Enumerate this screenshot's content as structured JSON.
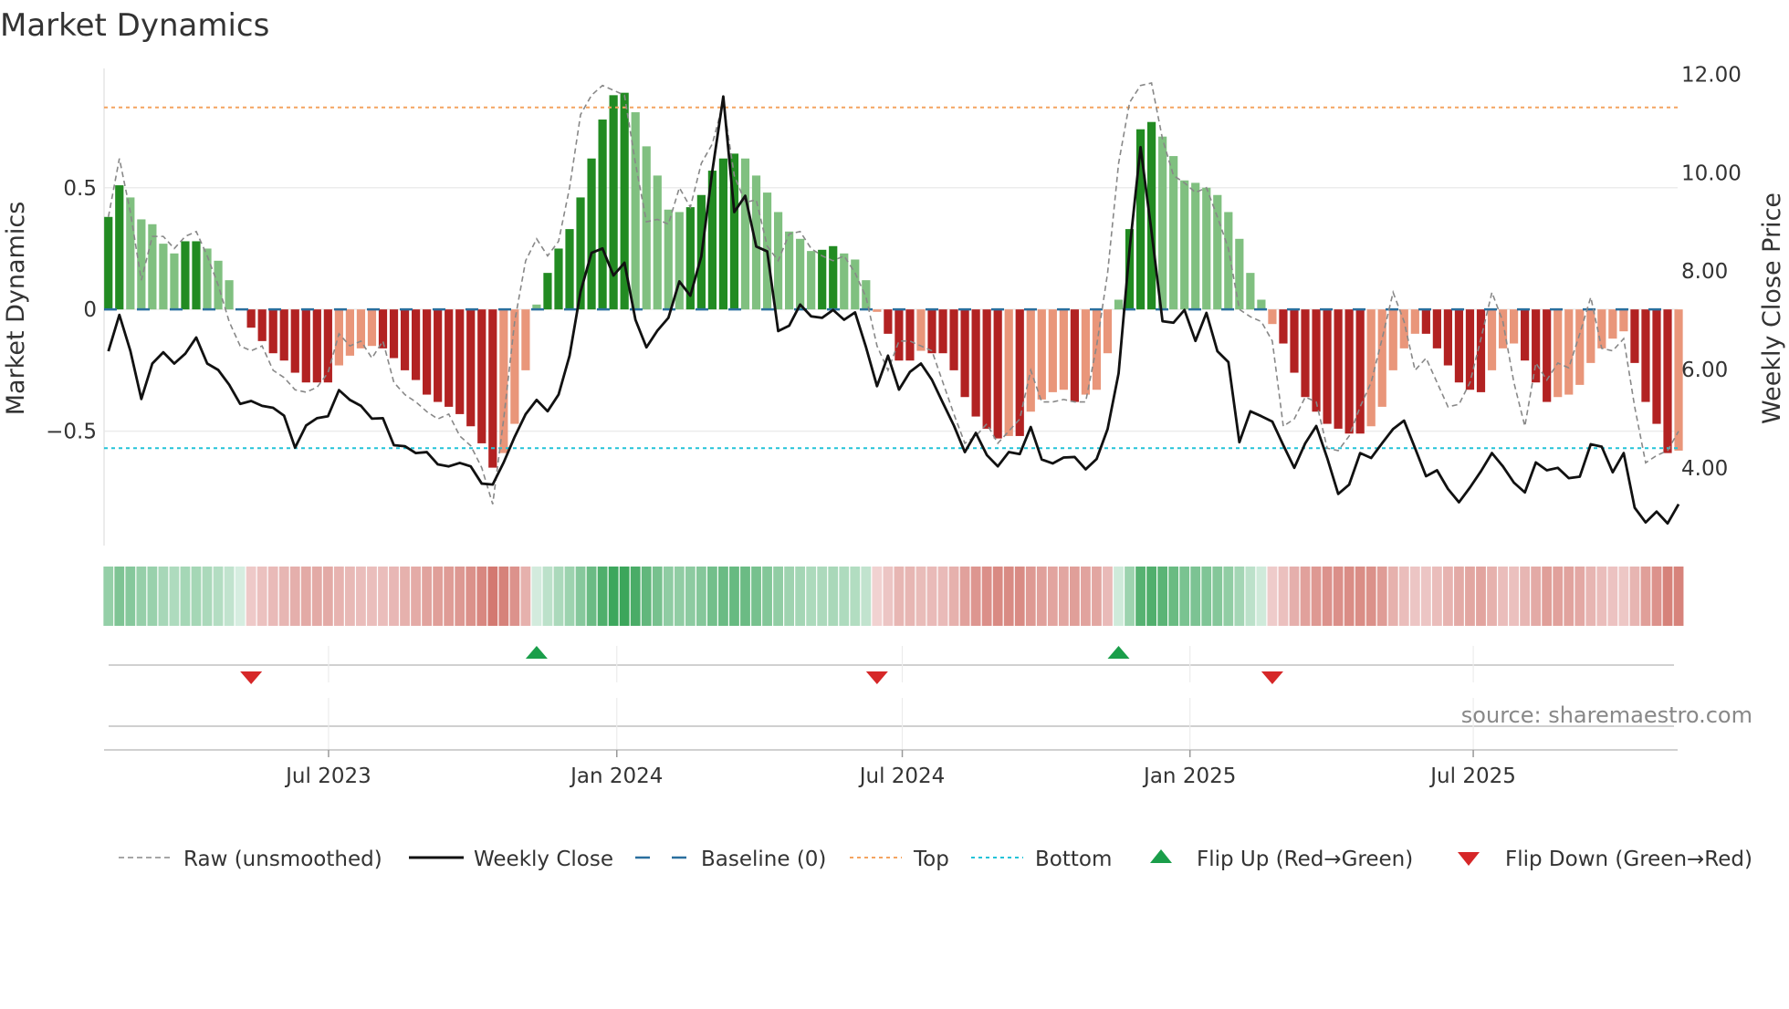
{
  "title": "Market Dynamics",
  "source": "source: sharemaestro.com",
  "colors": {
    "up_strong": "#228b22",
    "up_weak": "#80c080",
    "down_strong": "#b22222",
    "down_weak": "#e9967a",
    "baseline": "#2a6f9e",
    "top": "#f4a460",
    "bottom": "#22c3d8",
    "raw": "#888888",
    "close": "#111111",
    "flip_up": "#1a9e4a",
    "flip_down": "#d62728"
  },
  "chart_data": {
    "type": "bar",
    "title": "Market Dynamics",
    "ylabel": "Market Dynamics",
    "y2label": "Weekly Close Price",
    "ylim": [
      -0.97,
      0.99
    ],
    "y2lim": [
      2.42,
      12.12
    ],
    "yticks": [
      {
        "v": 0.5,
        "label": "0.5"
      },
      {
        "v": 0,
        "label": "0"
      },
      {
        "v": -0.5,
        "label": "−0.5"
      }
    ],
    "y2ticks": [
      {
        "v": 12,
        "label": "12.00"
      },
      {
        "v": 10,
        "label": "10.00"
      },
      {
        "v": 8,
        "label": "8.00"
      },
      {
        "v": 6,
        "label": "6.00"
      },
      {
        "v": 4,
        "label": "4.00"
      }
    ],
    "xticks": [
      {
        "index": 20.05,
        "label": "Jul 2023"
      },
      {
        "index": 46.3,
        "label": "Jan 2024"
      },
      {
        "index": 72.3,
        "label": "Jul 2024"
      },
      {
        "index": 98.5,
        "label": "Jan 2025"
      },
      {
        "index": 124.3,
        "label": "Jul 2025"
      }
    ],
    "top_level": 0.83,
    "bottom_level": -0.57,
    "baseline": 0,
    "dynamics": [
      0.38,
      0.51,
      0.46,
      0.37,
      0.35,
      0.27,
      0.23,
      0.28,
      0.28,
      0.25,
      0.2,
      0.12,
      0.0,
      -0.075,
      -0.13,
      -0.18,
      -0.21,
      -0.26,
      -0.3,
      -0.3,
      -0.3,
      -0.23,
      -0.19,
      -0.16,
      -0.15,
      -0.16,
      -0.2,
      -0.25,
      -0.29,
      -0.35,
      -0.38,
      -0.4,
      -0.43,
      -0.48,
      -0.55,
      -0.65,
      -0.59,
      -0.47,
      -0.25,
      0.02,
      0.15,
      0.25,
      0.33,
      0.46,
      0.62,
      0.78,
      0.88,
      0.89,
      0.81,
      0.67,
      0.55,
      0.41,
      0.4,
      0.42,
      0.47,
      0.57,
      0.62,
      0.64,
      0.62,
      0.55,
      0.48,
      0.4,
      0.32,
      0.29,
      0.24,
      0.245,
      0.26,
      0.23,
      0.205,
      0.12,
      -0.01,
      -0.1,
      -0.21,
      -0.21,
      -0.17,
      -0.18,
      -0.18,
      -0.25,
      -0.36,
      -0.44,
      -0.49,
      -0.53,
      -0.52,
      -0.52,
      -0.42,
      -0.37,
      -0.34,
      -0.33,
      -0.38,
      -0.35,
      -0.33,
      -0.18,
      0.04,
      0.33,
      0.74,
      0.77,
      0.71,
      0.63,
      0.53,
      0.52,
      0.5,
      0.47,
      0.4,
      0.29,
      0.15,
      0.04,
      -0.06,
      -0.14,
      -0.26,
      -0.36,
      -0.42,
      -0.47,
      -0.49,
      -0.51,
      -0.51,
      -0.48,
      -0.4,
      -0.25,
      -0.16,
      -0.1,
      -0.1,
      -0.16,
      -0.23,
      -0.3,
      -0.33,
      -0.34,
      -0.25,
      -0.16,
      -0.14,
      -0.21,
      -0.3,
      -0.38,
      -0.36,
      -0.35,
      -0.31,
      -0.22,
      -0.16,
      -0.12,
      -0.09,
      -0.22,
      -0.38,
      -0.47,
      -0.59,
      -0.58
    ],
    "raw": [
      0.38,
      0.62,
      0.4,
      0.12,
      0.3,
      0.3,
      0.25,
      0.3,
      0.32,
      0.22,
      0.1,
      -0.05,
      -0.15,
      -0.17,
      -0.15,
      -0.25,
      -0.28,
      -0.33,
      -0.34,
      -0.32,
      -0.26,
      -0.1,
      -0.15,
      -0.13,
      -0.2,
      -0.13,
      -0.3,
      -0.35,
      -0.38,
      -0.42,
      -0.45,
      -0.43,
      -0.52,
      -0.56,
      -0.65,
      -0.8,
      -0.45,
      -0.05,
      0.2,
      0.29,
      0.22,
      0.28,
      0.5,
      0.8,
      0.88,
      0.92,
      0.9,
      0.88,
      0.6,
      0.36,
      0.37,
      0.35,
      0.5,
      0.42,
      0.6,
      0.68,
      0.85,
      0.55,
      0.44,
      0.45,
      0.26,
      0.2,
      0.31,
      0.32,
      0.25,
      0.22,
      0.2,
      0.22,
      0.15,
      0.05,
      -0.15,
      -0.25,
      -0.13,
      -0.13,
      -0.15,
      -0.17,
      -0.3,
      -0.43,
      -0.55,
      -0.52,
      -0.47,
      -0.55,
      -0.5,
      -0.45,
      -0.25,
      -0.38,
      -0.38,
      -0.37,
      -0.38,
      -0.38,
      -0.15,
      0.15,
      0.6,
      0.85,
      0.92,
      0.93,
      0.7,
      0.55,
      0.52,
      0.48,
      0.5,
      0.38,
      0.25,
      0.0,
      -0.03,
      -0.05,
      -0.13,
      -0.48,
      -0.45,
      -0.36,
      -0.38,
      -0.57,
      -0.58,
      -0.52,
      -0.4,
      -0.3,
      -0.12,
      0.07,
      -0.05,
      -0.25,
      -0.2,
      -0.3,
      -0.4,
      -0.39,
      -0.3,
      -0.12,
      0.07,
      -0.05,
      -0.3,
      -0.48,
      -0.22,
      -0.29,
      -0.22,
      -0.24,
      -0.1,
      0.05,
      -0.16,
      -0.17,
      -0.12,
      -0.4,
      -0.63,
      -0.6,
      -0.58,
      -0.5
    ],
    "weekly_close": [
      6.37,
      7.11,
      6.38,
      5.4,
      6.12,
      6.35,
      6.12,
      6.32,
      6.65,
      6.12,
      5.99,
      5.69,
      5.3,
      5.36,
      5.26,
      5.22,
      5.06,
      4.41,
      4.86,
      5.01,
      5.05,
      5.58,
      5.38,
      5.26,
      5.0,
      5.01,
      4.46,
      4.44,
      4.3,
      4.32,
      4.07,
      4.03,
      4.1,
      4.03,
      3.68,
      3.66,
      4.11,
      4.63,
      5.09,
      5.38,
      5.15,
      5.49,
      6.28,
      7.58,
      8.37,
      8.46,
      7.91,
      8.17,
      7.01,
      6.45,
      6.79,
      7.05,
      7.79,
      7.5,
      8.3,
      10.03,
      11.55,
      9.2,
      9.53,
      8.5,
      8.4,
      6.78,
      6.89,
      7.32,
      7.08,
      7.05,
      7.21,
      7.01,
      7.16,
      6.45,
      5.66,
      6.28,
      5.59,
      5.95,
      6.12,
      5.79,
      5.32,
      4.86,
      4.32,
      4.71,
      4.26,
      4.03,
      4.32,
      4.28,
      4.83,
      4.17,
      4.09,
      4.21,
      4.22,
      3.97,
      4.18,
      4.79,
      5.92,
      8.44,
      10.52,
      8.8,
      6.98,
      6.95,
      7.21,
      6.58,
      7.15,
      6.37,
      6.15,
      4.52,
      5.15,
      5.05,
      4.94,
      4.46,
      4.0,
      4.5,
      4.85,
      4.2,
      3.47,
      3.66,
      4.3,
      4.2,
      4.5,
      4.79,
      4.96,
      4.4,
      3.83,
      3.95,
      3.57,
      3.3,
      3.6,
      3.93,
      4.3,
      4.03,
      3.7,
      3.5,
      4.11,
      3.95,
      4.0,
      3.79,
      3.82,
      4.48,
      4.43,
      3.91,
      4.3,
      3.19,
      2.89,
      3.11,
      2.87,
      3.26
    ],
    "flip_up": [
      39,
      92
    ],
    "flip_down": [
      13,
      70,
      106
    ],
    "legend": [
      {
        "label": "Raw (unsmoothed)",
        "kind": "raw"
      },
      {
        "label": "Weekly Close",
        "kind": "close"
      },
      {
        "label": "Baseline (0)",
        "kind": "baseline"
      },
      {
        "label": "Top",
        "kind": "top"
      },
      {
        "label": "Bottom",
        "kind": "bottom"
      },
      {
        "label": "Flip Up (Red→Green)",
        "kind": "flip_up"
      },
      {
        "label": "Flip Down (Green→Red)",
        "kind": "flip_down"
      }
    ],
    "legend_position": "bottom"
  }
}
